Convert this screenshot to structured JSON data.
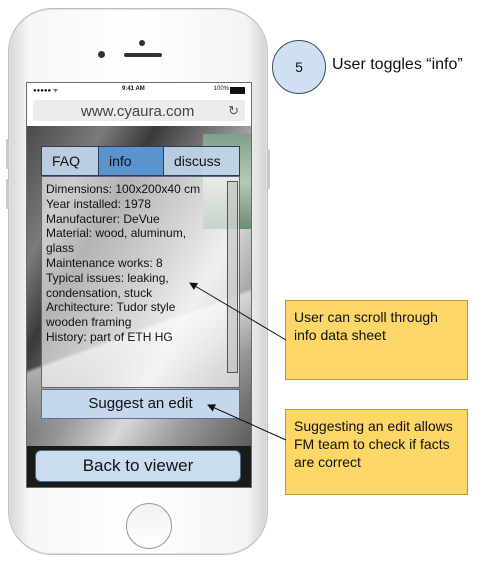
{
  "step": {
    "number": "5",
    "label": "User toggles “info”"
  },
  "status_bar": {
    "signal": "●●●●● ᯤ",
    "time": "9:41 AM",
    "battery_text": "100%"
  },
  "browser": {
    "url": "www.cyaura.com",
    "reload_icon": "reload-icon"
  },
  "tabs": [
    {
      "label": "FAQ",
      "active": false
    },
    {
      "label": "info",
      "active": true
    },
    {
      "label": "discuss",
      "active": false
    }
  ],
  "info_sheet": {
    "lines": [
      "Dimensions: 100x200x40 cm",
      "Year installed: 1978",
      "Manufacturer: DeVue",
      "Material: wood, aluminum,\nglass",
      "Maintenance works: 8",
      "Typical issues: leaking,\ncondensation, stuck",
      "Architecture: Tudor style\nwooden framing",
      "History: part of ETH HG"
    ]
  },
  "buttons": {
    "suggest_edit": "Suggest an edit",
    "back_to_viewer": "Back to viewer"
  },
  "notes": {
    "scroll": "User can scroll through info data sheet",
    "edit": "Suggesting an edit allows FM team to check if facts are correct"
  },
  "colors": {
    "active_tab": "#5b93cf",
    "tab": "#c1d5ec",
    "note": "#fcd667",
    "circle": "#cfe0f3"
  }
}
